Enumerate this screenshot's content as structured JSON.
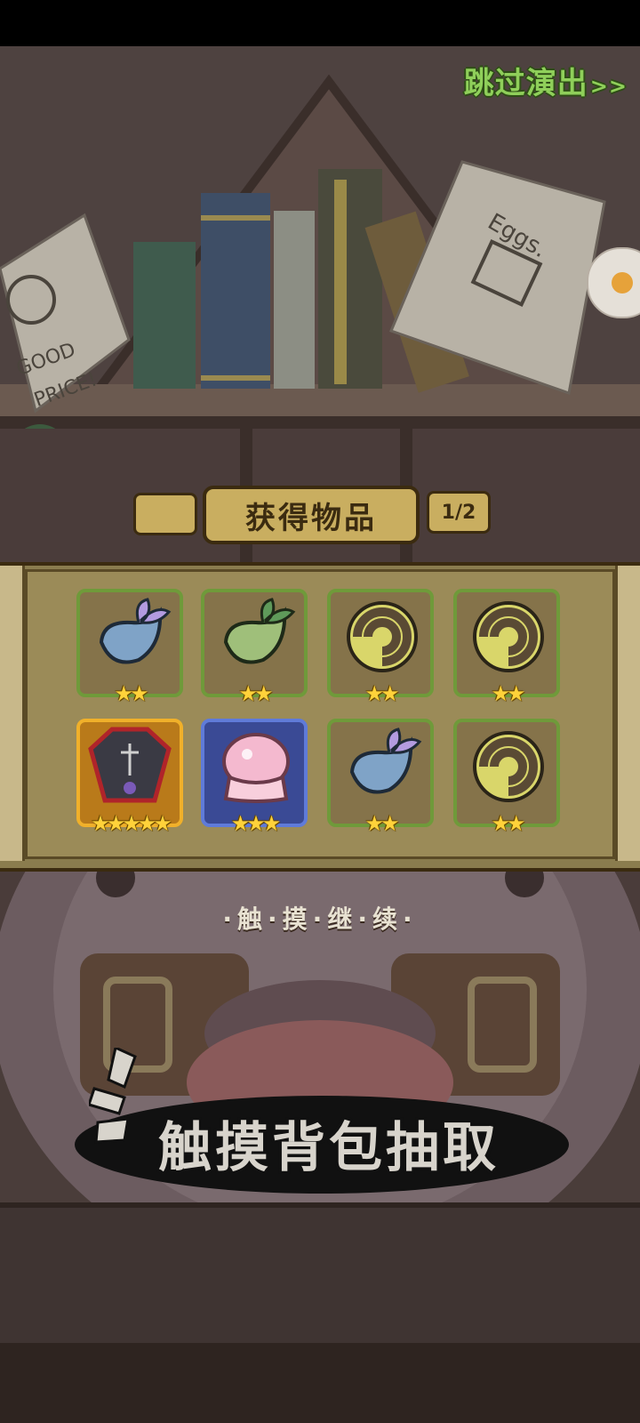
{
  "header": {
    "skip_label": "跳过演出",
    "skip_arrow": ">>"
  },
  "rewards": {
    "title": "获得物品",
    "page": "1/2",
    "items": [
      {
        "name": "seed-purple",
        "stars": "★★",
        "frame": "green"
      },
      {
        "name": "seed-green",
        "stars": "★★",
        "frame": "green"
      },
      {
        "name": "snail-shell",
        "stars": "★★",
        "frame": "green"
      },
      {
        "name": "snail-shell",
        "stars": "★★",
        "frame": "green"
      },
      {
        "name": "coffin-card",
        "stars": "★★★★★",
        "frame": "gold"
      },
      {
        "name": "pink-jelly",
        "stars": "★★★",
        "frame": "blue"
      },
      {
        "name": "seed-purple",
        "stars": "★★",
        "frame": "green"
      },
      {
        "name": "snail-shell",
        "stars": "★★",
        "frame": "green"
      }
    ]
  },
  "hints": {
    "continue": "·触·摸·继·续·",
    "draw": "触摸背包抽取"
  },
  "colors": {
    "skip_green": "#8fcf5a",
    "panel": "#9b8b58",
    "gold_frame": "#f0b02a",
    "blue_frame": "#5f7bd9",
    "green_frame": "#6f9a3a"
  }
}
